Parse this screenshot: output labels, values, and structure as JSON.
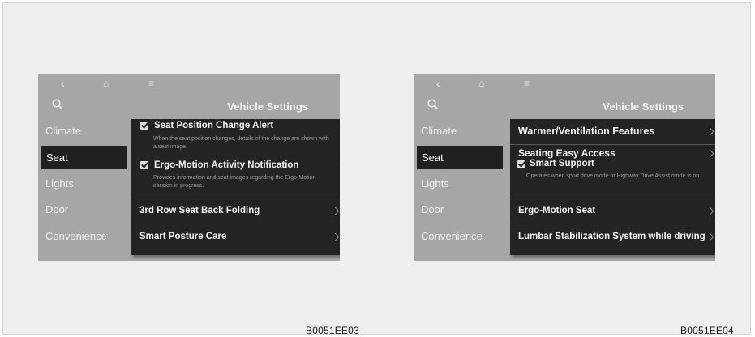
{
  "left_screen": {
    "title": "Vehicle Settings",
    "nav_icons": [
      "back-icon",
      "home-icon",
      "menu-icon",
      "search-icon"
    ],
    "sidebar": {
      "items": [
        "Climate",
        "Seat",
        "Lights",
        "Door",
        "Convenience"
      ],
      "active": "Seat"
    },
    "panel": {
      "items": [
        {
          "label": "Seat Position Change Alert",
          "checked": true,
          "description": "When the seat position changes, details of the change are shown with a seat image."
        },
        {
          "label": "Ergo-Motion Activity Notification",
          "checked": true,
          "description": "Provides information and seat images regarding the Ergo-Motion session in progress."
        },
        {
          "label": "3rd Row Seat Back Folding"
        },
        {
          "label": "Smart Posture Care"
        }
      ]
    }
  },
  "right_screen": {
    "title": "Vehicle Settings",
    "nav_icons": [
      "back-icon",
      "home-icon",
      "menu-icon",
      "search-icon"
    ],
    "sidebar": {
      "items": [
        "Climate",
        "Seat",
        "Lights",
        "Door",
        "Convenience"
      ],
      "active": "Seat"
    },
    "panel": {
      "items": [
        {
          "label": "Warmer/Ventilation Features"
        },
        {
          "label": "Seating Easy Access",
          "sub_label": "Smart Support",
          "checked": true,
          "description": "Operates when sport drive mode or Highway Drive Assist mode is on."
        },
        {
          "label": "Ergo-Motion Seat"
        },
        {
          "label": "Lumbar Stabilization System while driving"
        }
      ]
    }
  },
  "captions": [
    "B0051EE03",
    "B0051EE04"
  ],
  "colors": {
    "screen_bg": "#a6a6a6",
    "panel_bg": "#232323",
    "active_item_bg": "#202020",
    "page_bg": "#efefef"
  }
}
